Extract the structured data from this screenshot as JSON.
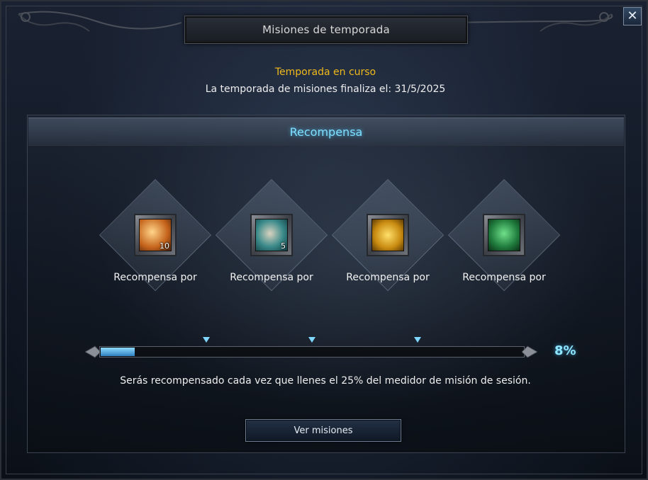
{
  "window": {
    "title": "Misiones de temporada",
    "close_label": "✕"
  },
  "season": {
    "status": "Temporada en curso",
    "end_text": "La temporada de misiones finaliza el: 31/5/2025"
  },
  "reward_panel": {
    "header": "Recompensa",
    "rewards": [
      {
        "label": "Recompensa por",
        "icon": "scroll-bundle-icon",
        "count": "10",
        "color": "#c4621a"
      },
      {
        "label": "Recompensa por",
        "icon": "scroll-icon",
        "count": "5",
        "color": "#3a8a8a"
      },
      {
        "label": "Recompensa por",
        "icon": "gold-medal-icon",
        "count": "",
        "color": "#c88a10"
      },
      {
        "label": "Recompensa por",
        "icon": "gift-box-icon",
        "count": "",
        "color": "#1f7a3c"
      }
    ]
  },
  "progress": {
    "percent_label": "8%",
    "fraction": 0.08,
    "marker_fractions": [
      0.25,
      0.5,
      0.75
    ],
    "info": "Serás recompensado cada vez que llenes el 25% del medidor de misión de sesión."
  },
  "actions": {
    "view_missions": "Ver misiones"
  }
}
